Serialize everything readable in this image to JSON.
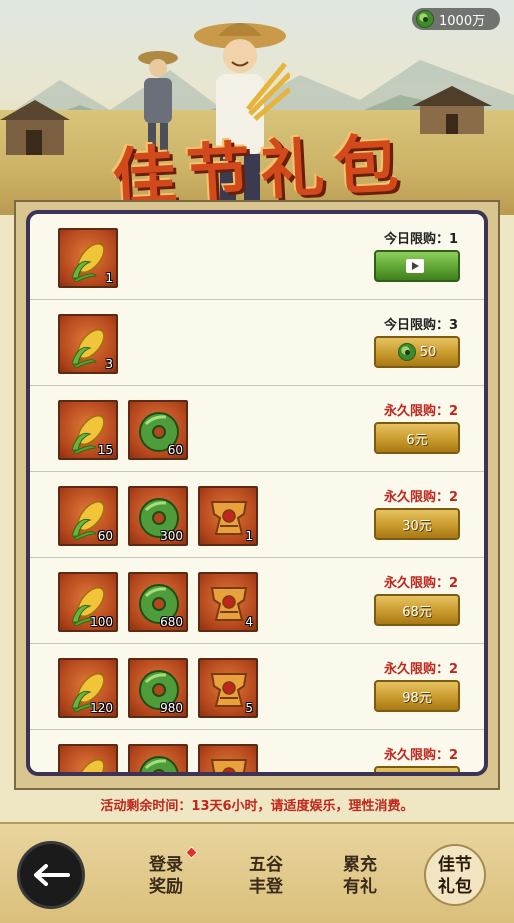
{
  "header": {
    "currency": {
      "icon": "jade-coin-icon",
      "amount": "1000万"
    },
    "title": "佳节礼包"
  },
  "rows": [
    {
      "items": [
        {
          "icon": "corn-icon",
          "qty": "1"
        }
      ],
      "limit_type": "today",
      "limit": "今日限购：1",
      "button": {
        "style": "green",
        "icon": "video-icon",
        "label": ""
      }
    },
    {
      "items": [
        {
          "icon": "corn-icon",
          "qty": "3"
        }
      ],
      "limit_type": "today",
      "limit": "今日限购：3",
      "button": {
        "style": "gold",
        "icon": "jade-coin-icon",
        "label": "50"
      }
    },
    {
      "items": [
        {
          "icon": "corn-icon",
          "qty": "15"
        },
        {
          "icon": "jade-coin-icon",
          "qty": "60"
        }
      ],
      "limit_type": "perm",
      "limit": "永久限购：2",
      "button": {
        "style": "gold",
        "icon": "",
        "label": "6元"
      }
    },
    {
      "items": [
        {
          "icon": "corn-icon",
          "qty": "60"
        },
        {
          "icon": "jade-coin-icon",
          "qty": "300"
        },
        {
          "icon": "armor-icon",
          "qty": "1"
        }
      ],
      "limit_type": "perm",
      "limit": "永久限购：2",
      "button": {
        "style": "gold",
        "icon": "",
        "label": "30元"
      }
    },
    {
      "items": [
        {
          "icon": "corn-icon",
          "qty": "100"
        },
        {
          "icon": "jade-coin-icon",
          "qty": "680"
        },
        {
          "icon": "armor-icon",
          "qty": "4"
        }
      ],
      "limit_type": "perm",
      "limit": "永久限购：2",
      "button": {
        "style": "gold",
        "icon": "",
        "label": "68元"
      }
    },
    {
      "items": [
        {
          "icon": "corn-icon",
          "qty": "120"
        },
        {
          "icon": "jade-coin-icon",
          "qty": "980"
        },
        {
          "icon": "armor-icon",
          "qty": "5"
        }
      ],
      "limit_type": "perm",
      "limit": "永久限购：2",
      "button": {
        "style": "gold",
        "icon": "",
        "label": "98元"
      }
    },
    {
      "items": [
        {
          "icon": "corn-icon",
          "qty": ""
        },
        {
          "icon": "jade-coin-icon",
          "qty": ""
        },
        {
          "icon": "armor-icon",
          "qty": ""
        }
      ],
      "limit_type": "perm",
      "limit": "永久限购：2",
      "button": {
        "style": "gold",
        "icon": "",
        "label": ""
      }
    }
  ],
  "notice": "活动剩余时间：13天6小时，请适度娱乐，理性消费。",
  "nav": {
    "back_icon": "back-arrow-icon",
    "tabs": [
      {
        "label_1": "登录",
        "label_2": "奖励",
        "badge": true,
        "active": false
      },
      {
        "label_1": "五谷",
        "label_2": "丰登",
        "badge": false,
        "active": false
      },
      {
        "label_1": "累充",
        "label_2": "有礼",
        "badge": false,
        "active": false
      },
      {
        "label_1": "佳节",
        "label_2": "礼包",
        "badge": false,
        "active": true
      }
    ]
  },
  "colors": {
    "perm_limit": "#c0261d",
    "gold_button": "#c99a2c",
    "green_button": "#5fa533",
    "panel_border": "#3c3357"
  }
}
